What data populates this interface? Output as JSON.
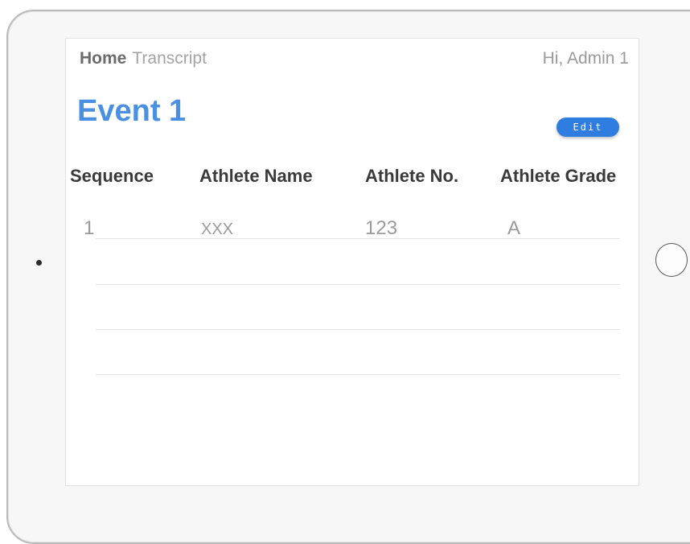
{
  "nav": {
    "home": "Home",
    "transcript": "Transcript"
  },
  "header": {
    "greeting": "Hi, Admin 1"
  },
  "page": {
    "title": "Event 1",
    "edit_label": "Edit"
  },
  "table": {
    "columns": [
      "Sequence",
      "Athlete Name",
      "Athlete No.",
      "Athlete Grade"
    ],
    "rows": [
      [
        "1",
        "XXX",
        "123",
        "A"
      ]
    ]
  },
  "colors": {
    "accent": "#4a90e2",
    "button": "#2f7de0"
  }
}
